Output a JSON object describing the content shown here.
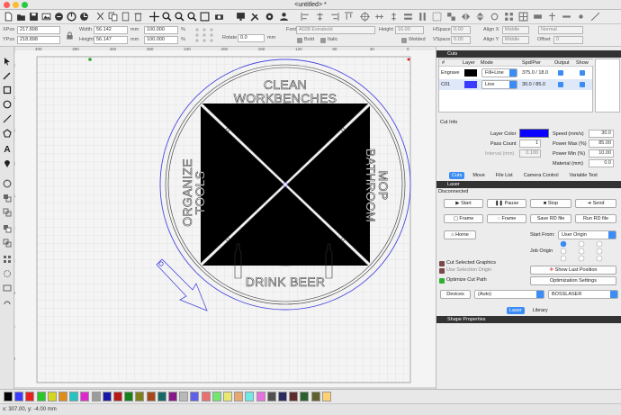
{
  "window": {
    "title": "<untitled> *"
  },
  "props": {
    "xpos_label": "XPos",
    "xpos": "217.898",
    "ypos_label": "YPos",
    "ypos": "218.898",
    "width_label": "Width",
    "width": "56.142",
    "height_label": "Height",
    "height": "56.147",
    "unit": "mm",
    "pct_w": "100.000",
    "pct_h": "100.000",
    "pct": "%",
    "rotate_label": "Rotate",
    "rotate": "0.0",
    "rotate_unit": "mm",
    "font_label": "Font",
    "font": "A028 Extrabold",
    "fheight_label": "Height",
    "fheight": "16.00",
    "bold": "Bold",
    "italic": "Italic",
    "welded": "Welded",
    "hspace_label": "HSpace",
    "hspace": "0.00",
    "vspace_label": "VSpace",
    "vspace": "0.00",
    "alignx_label": "Align X",
    "alignx": "Middle",
    "aligny_label": "Align Y",
    "aligny": "Middle",
    "normal": "Normal",
    "offset_label": "Offset",
    "offset": "0"
  },
  "ruler": {
    "h": [
      "400",
      "360",
      "320",
      "280",
      "240",
      "200",
      "160",
      "120",
      "80",
      "40",
      "0"
    ],
    "v": [
      "360",
      "320",
      "280",
      "240",
      "200",
      "160",
      "120",
      "80",
      "40",
      "0"
    ]
  },
  "design": {
    "top": [
      "CLEAN",
      "WORKBENCHES"
    ],
    "left": [
      "ORGANIZE",
      "TOOLS"
    ],
    "right": [
      "MOP",
      "BATHROOM"
    ],
    "bottom": "DRINK BEER"
  },
  "cuts": {
    "title": "Cuts",
    "headers": [
      "#",
      "Layer",
      "Mode",
      "Spd/Pwr",
      "Output",
      "Show"
    ],
    "rows": [
      {
        "num": "Engrave",
        "color": "#000000",
        "mode": "Fill+Line",
        "spdpwr": "375.0 / 18.0"
      },
      {
        "num": "C01",
        "color": "#3b3bff",
        "mode": "Line",
        "spdpwr": "30.0 / 85.0"
      }
    ],
    "info_label": "Cut Info",
    "layer_color_label": "Layer Color",
    "layer_color": "#0a00ff",
    "pass_label": "Pass Count",
    "pass": "1",
    "interval_label": "Interval (mm)",
    "interval": "0.100",
    "speed_label": "Speed (mm/s)",
    "speed": "30.0",
    "pmax_label": "Power Max (%)",
    "pmax": "85.00",
    "pmin_label": "Power Min (%)",
    "pmin": "10.00",
    "material_label": "Material (mm)",
    "material": "0.0",
    "tabs": [
      "Cuts",
      "Move",
      "File List",
      "Camera Control",
      "Variable Text"
    ]
  },
  "laser": {
    "title": "Laser",
    "status": "Disconnected",
    "start": "Start",
    "pause": "Pause",
    "stop": "Stop",
    "send": "Send",
    "frame1": "Frame",
    "frame2": "Frame",
    "save_rd": "Save RD file",
    "run_rd": "Run RD file",
    "home": "Home",
    "start_from_label": "Start From:",
    "start_from": "User Origin",
    "job_origin": "Job Origin",
    "cut_selected": "Cut Selected Graphics",
    "use_selection": "Use Selection Origin",
    "optimize": "Optimize Cut Path",
    "show_last": "Show Last Position",
    "opt_settings": "Optimization Settings",
    "devices": "Devices",
    "auto": "(Auto)",
    "device": "BOSSLASER",
    "tabs": [
      "Laser",
      "Library"
    ]
  },
  "shape_props": {
    "title": "Shape Properties"
  },
  "palette": [
    "#000000",
    "#3b3bff",
    "#e82020",
    "#26c926",
    "#d6d61c",
    "#e08c18",
    "#24c4c4",
    "#e026d0",
    "#9c9c9c",
    "#1818a8",
    "#b81818",
    "#188018",
    "#808018",
    "#a84818",
    "#186868",
    "#881888",
    "#b8b8b8",
    "#6060e8",
    "#e87070",
    "#70e870",
    "#e8e870",
    "#e8a870",
    "#70e8e8",
    "#e870e0",
    "#505050",
    "#2c2c60",
    "#602c2c",
    "#2c602c",
    "#60602c",
    "#ffd070"
  ],
  "status": {
    "coords": "x: 307.00, y: -4.00 mm"
  }
}
